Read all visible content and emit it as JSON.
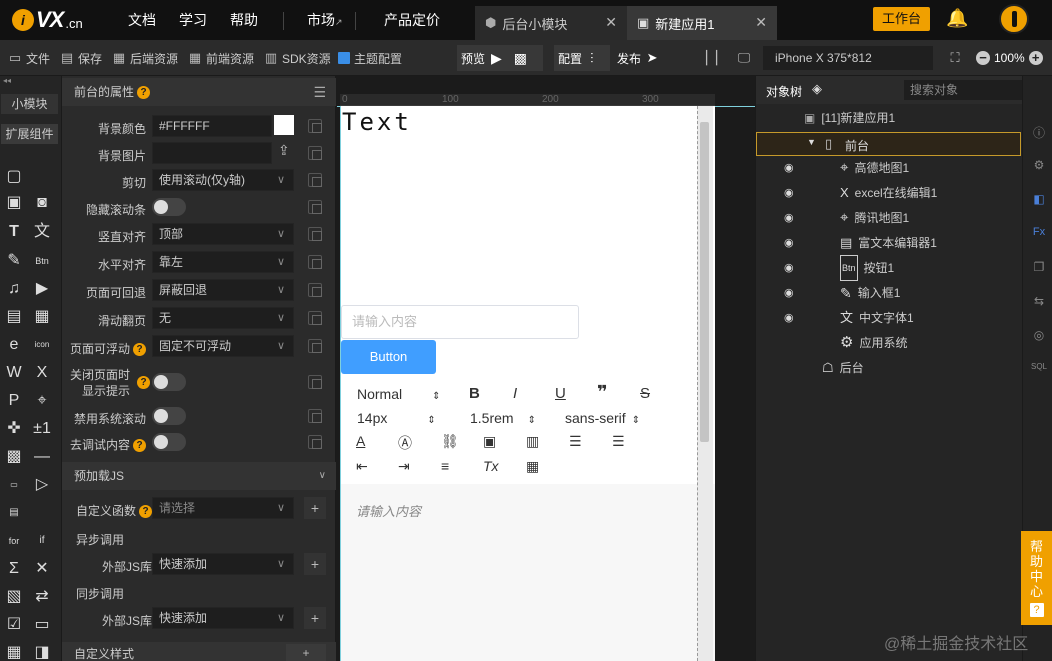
{
  "topbar": {
    "logo_cn": ".cn",
    "logo_vx": "VX",
    "nav": [
      "文档",
      "学习",
      "帮助"
    ],
    "market": "市场",
    "pricing": "产品定价",
    "tabs": [
      {
        "label": "后台小模块",
        "active": false
      },
      {
        "label": "新建应用1",
        "active": true
      }
    ],
    "workbench": "工作台"
  },
  "toolbar": {
    "file": "文件",
    "save": "保存",
    "backend_res": "后端资源",
    "frontend_res": "前端资源",
    "sdk_res": "SDK资源",
    "theme": "主题配置",
    "preview": "预览",
    "config": "配置",
    "publish": "发布",
    "device": "iPhone X 375*812",
    "zoom": "100%"
  },
  "leftcol": {
    "small_module": "小模块",
    "ext_components": "扩展组件"
  },
  "props": {
    "header": "前台的属性",
    "rows": [
      {
        "label": "背景颜色",
        "value": "#FFFFFF"
      },
      {
        "label": "背景图片",
        "value": ""
      },
      {
        "label": "剪切",
        "value": "使用滚动(仅y轴)"
      },
      {
        "label": "隐藏滚动条",
        "value": ""
      },
      {
        "label": "竖直对齐",
        "value": "顶部"
      },
      {
        "label": "水平对齐",
        "value": "靠左"
      },
      {
        "label": "页面可回退",
        "value": "屏蔽回退"
      },
      {
        "label": "滑动翻页",
        "value": "无"
      },
      {
        "label": "页面可浮动",
        "value": "固定不可浮动"
      },
      {
        "label": "关闭页面时",
        "value": ""
      },
      {
        "label": "显示提示",
        "value": ""
      },
      {
        "label": "禁用系统滚动",
        "value": ""
      },
      {
        "label": "去调试内容",
        "value": ""
      }
    ],
    "preload_header": "预加载JS",
    "custom_func_label": "自定义函数",
    "custom_func_placeholder": "请选择",
    "async_call": "异步调用",
    "external_js": "外部JS库",
    "quick_add": "快速添加",
    "sync_call": "同步调用",
    "external_js2": "外部JS库",
    "quick_add2": "快速添加",
    "custom_style": "自定义样式"
  },
  "ruler": [
    "0",
    "100",
    "200",
    "300"
  ],
  "canvas": {
    "text": "Text",
    "input_placeholder": "请输入内容",
    "button": "Button",
    "editor_format": "Normal",
    "editor_size": "14px",
    "editor_line": "1.5rem",
    "editor_font": "sans-serif",
    "editor_placeholder": "请输入内容"
  },
  "objtree": {
    "title": "对象树",
    "search_placeholder": "搜索对象",
    "app": "[11]新建应用1",
    "front": "前台",
    "items": [
      "高德地图1",
      "excel在线编辑1",
      "腾讯地图1",
      "富文本编辑器1",
      "按钮1",
      "输入框1",
      "中文字体1",
      "应用系统"
    ],
    "back": "后台"
  },
  "help": "帮助中心",
  "watermark": "@稀土掘金技术社区"
}
